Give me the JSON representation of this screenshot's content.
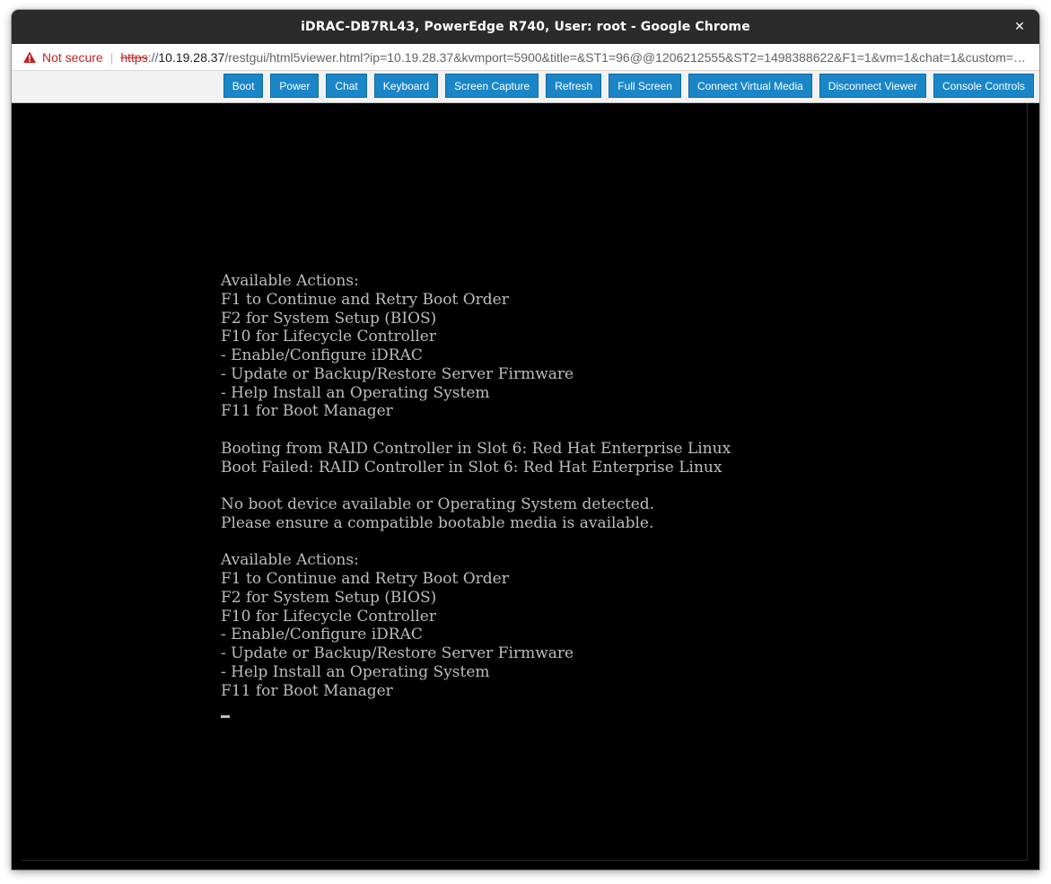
{
  "window": {
    "title": "iDRAC-DB7RL43, PowerEdge R740, User: root - Google Chrome",
    "close_symbol": "✕"
  },
  "address_bar": {
    "security_icon": "warning-triangle-icon",
    "security_label": "Not secure",
    "separator": "|",
    "scheme": "https",
    "scheme_sep": "://",
    "host": "10.19.28.37",
    "path": "/restgui/html5viewer.html?ip=10.19.28.37&kvmport=5900&title=&ST1=96@@1206212555&ST2=1498388622&F1=1&vm=1&chat=1&custom=…"
  },
  "toolbar": {
    "buttons": [
      {
        "label": "Boot"
      },
      {
        "label": "Power"
      },
      {
        "label": "Chat"
      },
      {
        "label": "Keyboard"
      },
      {
        "label": "Screen Capture"
      },
      {
        "label": "Refresh"
      },
      {
        "label": "Full Screen"
      },
      {
        "label": "Connect Virtual Media"
      },
      {
        "label": "Disconnect Viewer"
      },
      {
        "label": "Console Controls"
      }
    ]
  },
  "console": {
    "lines": [
      "Available Actions:",
      "F1 to Continue and Retry Boot Order",
      "F2 for System Setup (BIOS)",
      "F10 for Lifecycle Controller",
      "- Enable/Configure iDRAC",
      "- Update or Backup/Restore Server Firmware",
      "- Help Install an Operating System",
      "F11 for Boot Manager",
      "",
      "Booting from RAID Controller in Slot 6: Red Hat Enterprise Linux",
      "Boot Failed: RAID Controller in Slot 6: Red Hat Enterprise Linux",
      "",
      "No boot device available or Operating System detected.",
      "Please ensure a compatible bootable media is available.",
      "",
      "Available Actions:",
      "F1 to Continue and Retry Boot Order",
      "F2 for System Setup (BIOS)",
      "F10 for Lifecycle Controller",
      "- Enable/Configure iDRAC",
      "- Update or Backup/Restore Server Firmware",
      "- Help Install an Operating System",
      "F11 for Boot Manager"
    ]
  },
  "colors": {
    "toolbar_button": "#1a86c8",
    "console_text": "#bdbdbd",
    "not_secure": "#c5221f"
  }
}
